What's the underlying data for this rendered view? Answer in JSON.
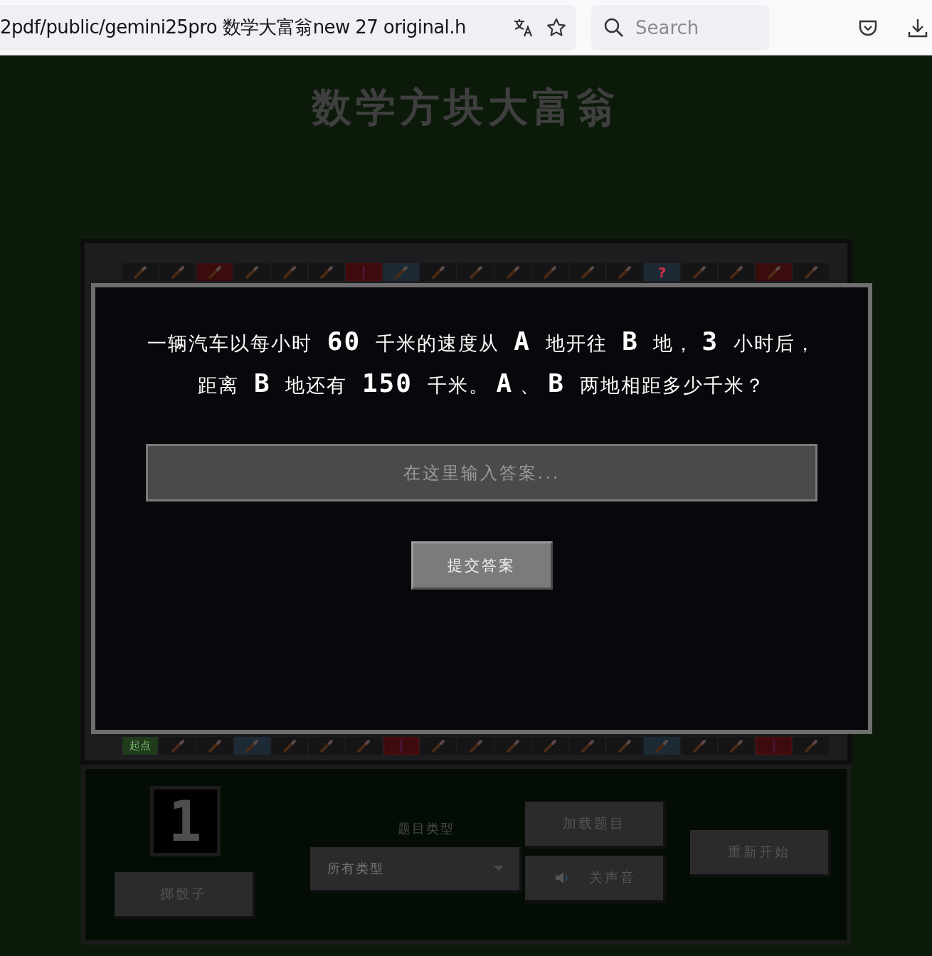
{
  "browser": {
    "url": "2pdf/public/gemini25pro 数学大富翁new 27 original.h",
    "search": {
      "placeholder": "Search"
    }
  },
  "title": "数学方块大富翁",
  "board": {
    "top_row": [
      {
        "kind": "normal"
      },
      {
        "kind": "normal"
      },
      {
        "kind": "trap"
      },
      {
        "kind": "normal"
      },
      {
        "kind": "normal"
      },
      {
        "kind": "normal"
      },
      {
        "kind": "chest"
      },
      {
        "kind": "quiz_pencil"
      },
      {
        "kind": "normal"
      },
      {
        "kind": "normal"
      },
      {
        "kind": "normal"
      },
      {
        "kind": "normal"
      },
      {
        "kind": "normal"
      },
      {
        "kind": "normal"
      },
      {
        "kind": "quiz",
        "label": "?"
      },
      {
        "kind": "normal"
      },
      {
        "kind": "normal"
      },
      {
        "kind": "trap"
      },
      {
        "kind": "normal"
      }
    ],
    "bottom_row": [
      {
        "kind": "start",
        "label": "起点"
      },
      {
        "kind": "normal"
      },
      {
        "kind": "normal"
      },
      {
        "kind": "quiz_pencil"
      },
      {
        "kind": "normal"
      },
      {
        "kind": "normal"
      },
      {
        "kind": "normal"
      },
      {
        "kind": "chest"
      },
      {
        "kind": "normal"
      },
      {
        "kind": "normal"
      },
      {
        "kind": "normal"
      },
      {
        "kind": "normal"
      },
      {
        "kind": "normal"
      },
      {
        "kind": "normal"
      },
      {
        "kind": "quiz_pencil"
      },
      {
        "kind": "normal"
      },
      {
        "kind": "normal"
      },
      {
        "kind": "chest"
      },
      {
        "kind": "normal"
      }
    ]
  },
  "modal": {
    "question": "一辆汽车以每小时 **60** 千米的速度从 **A** 地开往 **B** 地，**3** 小时后，距离 **B** 地还有 **150** 千米。**A**、**B** 两地相距多少千米？",
    "answer": {
      "placeholder": "在这里输入答案..."
    },
    "submit": "提交答案"
  },
  "controls": {
    "dice": "1",
    "roll": "掷骰子",
    "type_label": "题目类型",
    "type_select": {
      "value": "所有类型"
    },
    "load": "加载题目",
    "sound": "关声音",
    "restart": "重新开始"
  }
}
